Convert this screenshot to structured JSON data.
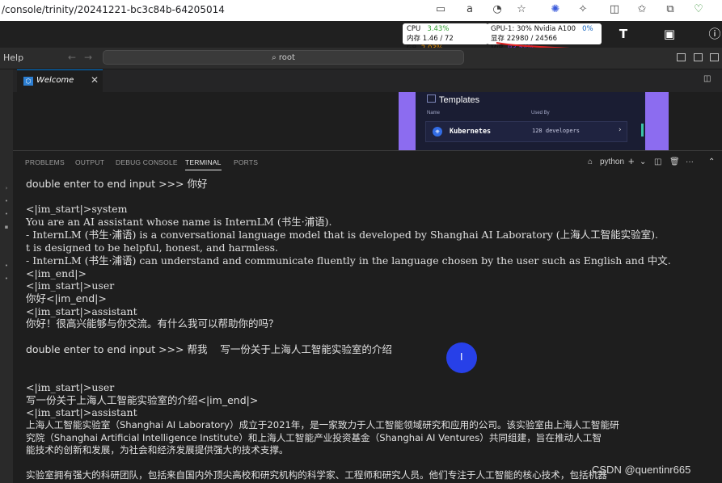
{
  "browser": {
    "url": "/console/trinity/20241221-bc3c84b-64205014",
    "icons": [
      "reader-icon",
      "translate-icon",
      "tracking-icon",
      "star-icon",
      "extension-icon",
      "extension-puzzle-icon",
      "split-screen-icon",
      "favorites-icon",
      "collections-icon",
      "browser-essentials-icon"
    ]
  },
  "system": {
    "cpu_label": "CPU",
    "cpu_value": "3.43%",
    "mem_label": "内存",
    "mem_value": "1.46 / 72 GB",
    "mem_pct": "2.03%",
    "gpu_label": "GPU-1: 30% Nvidia A100",
    "gpu_pct": "0%",
    "vram_label": "显存",
    "vram_value": "22980 / 24566 MiB",
    "vram_pct": "93.54%"
  },
  "titlebar": {
    "menu_help": "Help",
    "search_text": "root"
  },
  "editor_tabs": [
    {
      "label": "Welcome"
    }
  ],
  "templates_card": {
    "title": "Templates",
    "col_name": "Name",
    "col_used_by": "Used By",
    "row_name": "Kubernetes",
    "row_devs": "128 developers"
  },
  "panel": {
    "tabs": [
      "PROBLEMS",
      "OUTPUT",
      "DEBUG CONSOLE",
      "TERMINAL",
      "PORTS"
    ],
    "active_tab": "TERMINAL",
    "shell": "python"
  },
  "terminal": [
    {
      "text": "double enter to end input >>> 你好"
    },
    {
      "text": ""
    },
    {
      "text": "<|im_start|>system"
    },
    {
      "text": "You are an AI assistant whose name is InternLM (书生·浦语)."
    },
    {
      "text": "- InternLM (书生·浦语) is a conversational language model that is developed by Shanghai AI Laboratory (上海人工智能实验室)."
    },
    {
      "text": "t is designed to be helpful, honest, and harmless."
    },
    {
      "text": "- InternLM (书生·浦语) can understand and communicate fluently in the language chosen by the user such as English and 中文."
    },
    {
      "text": "<|im_end|>"
    },
    {
      "text": "<|im_start|>user"
    },
    {
      "text": "你好<|im_end|>"
    },
    {
      "text": "<|im_start|>assistant"
    },
    {
      "text": "你好！很高兴能够与你交流。有什么我可以帮助你的吗？"
    },
    {
      "text": ""
    },
    {
      "text": "double enter to end input >>> 帮我    写一份关于上海人工智能实验室的介绍"
    },
    {
      "text": ""
    },
    {
      "text": ""
    },
    {
      "text": "<|im_start|>user"
    },
    {
      "text": "写一份关于上海人工智能实验室的介绍<|im_end|>"
    },
    {
      "text": "<|im_start|>assistant"
    },
    {
      "text": "上海人工智能实验室（Shanghai AI Laboratory）成立于2021年，是一家致力于人工智能领域研究和应用的公司。该实验室由上海人工智能研"
    },
    {
      "text": "究院（Shanghai Artificial Intelligence Institute）和上海人工智能产业投资基金（Shanghai AI Ventures）共同组建，旨在推动人工智"
    },
    {
      "text": "能技术的创新和发展，为社会和经济发展提供强大的技术支撑。"
    },
    {
      "text": ""
    },
    {
      "text": "实验室拥有强大的科研团队，包括来自国内外顶尖高校和研究机构的科学家、工程师和研究人员。他们专注于人工智能的核心技术，包括机器"
    }
  ],
  "watermark": "CSDN @quentinr665"
}
